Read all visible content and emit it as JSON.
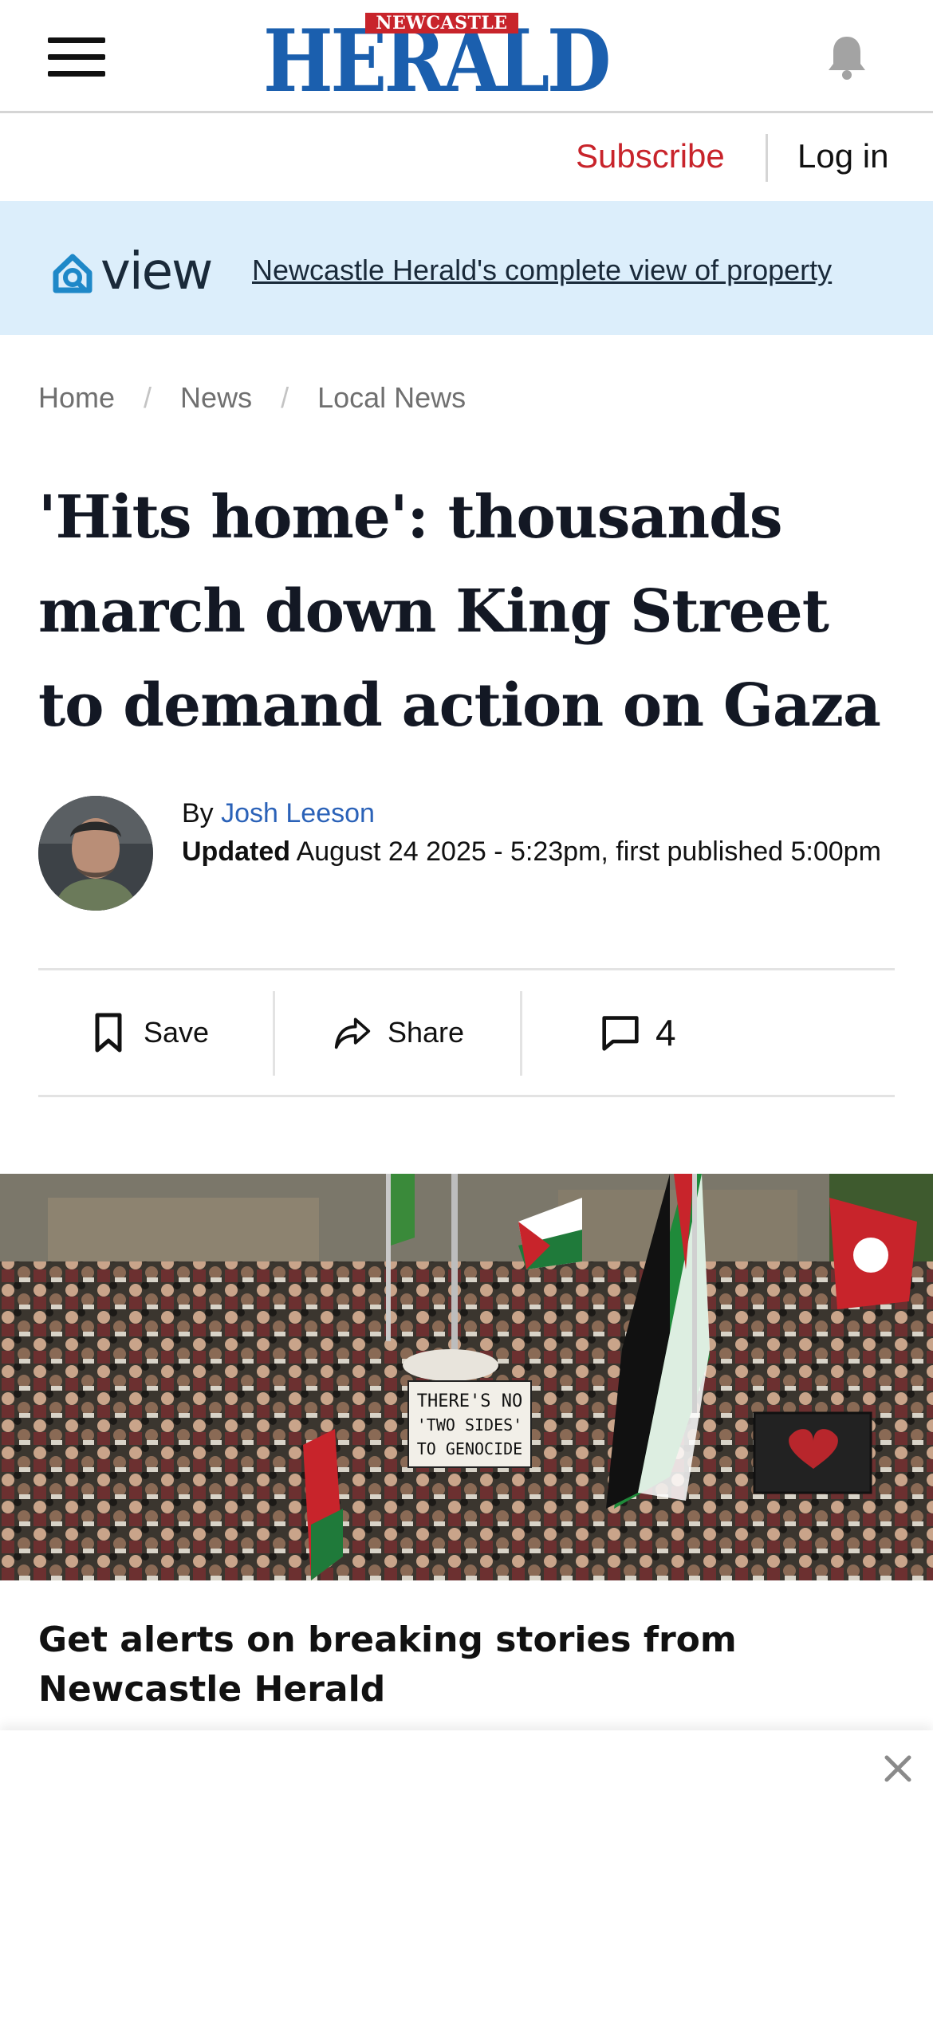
{
  "header": {
    "logo_small": "NEWCASTLE",
    "logo_big": "HERALD",
    "brand_blue": "#1b5fae",
    "brand_red": "#c8242b"
  },
  "auth": {
    "subscribe_label": "Subscribe",
    "login_label": "Log in"
  },
  "view_banner": {
    "logo_text": "view",
    "link_text": "Newcastle Herald's complete view of property",
    "background": "#dceefb"
  },
  "breadcrumb": [
    {
      "label": "Home"
    },
    {
      "label": "News"
    },
    {
      "label": "Local News"
    }
  ],
  "article": {
    "headline": "'Hits home': thousands march down King Street to demand action on Gaza",
    "byline_prefix": "By ",
    "author": "Josh Leeson",
    "updated_label": "Updated",
    "updated_text": " August 24 2025 - 5:23pm, first published 5:00pm"
  },
  "actions": {
    "save_label": "Save",
    "share_label": "Share",
    "comments_count": "4"
  },
  "hero": {
    "sign_text": [
      "THERE'S NO",
      "'TWO SIDES'",
      "TO GENOCIDE"
    ]
  },
  "alerts": {
    "title": "Get alerts on breaking stories from Newcastle Herald"
  },
  "icons": [
    "menu-icon",
    "bell-icon",
    "view-logo-icon",
    "bookmark-icon",
    "share-icon",
    "comment-icon",
    "close-icon"
  ]
}
